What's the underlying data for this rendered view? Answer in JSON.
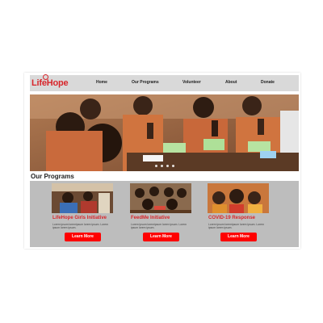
{
  "brand": {
    "name": "LifeHope",
    "color": "#d8262b"
  },
  "nav": {
    "items": [
      "Home",
      "Our Programs",
      "Volunteer",
      "About",
      "Donate"
    ]
  },
  "hero": {
    "slide_count": 4,
    "active_slide": 1
  },
  "programs": {
    "heading": "Our Programs",
    "cards": [
      {
        "title": "LifeHope Girls Initiative",
        "description": "Lorem ipsum loremipsum lorem ipsum. Lorem ipsum lorem ipsum.",
        "button": "Learn More"
      },
      {
        "title": "FeedMe Initiative",
        "description": "Lorem ipsum loremipsum lorem ipsum. Lorem ipsum lorem ipsum.",
        "button": "Learn More"
      },
      {
        "title": "COVID-19 Response",
        "description": "Lorem ipsum loremipsum lorem ipsum. Lorem ipsum lorem ipsum.",
        "button": "Learn More"
      }
    ]
  },
  "colors": {
    "accent": "#ff0000",
    "nav_bg": "#d9d9d9",
    "programs_bg": "#bdbdbd"
  }
}
